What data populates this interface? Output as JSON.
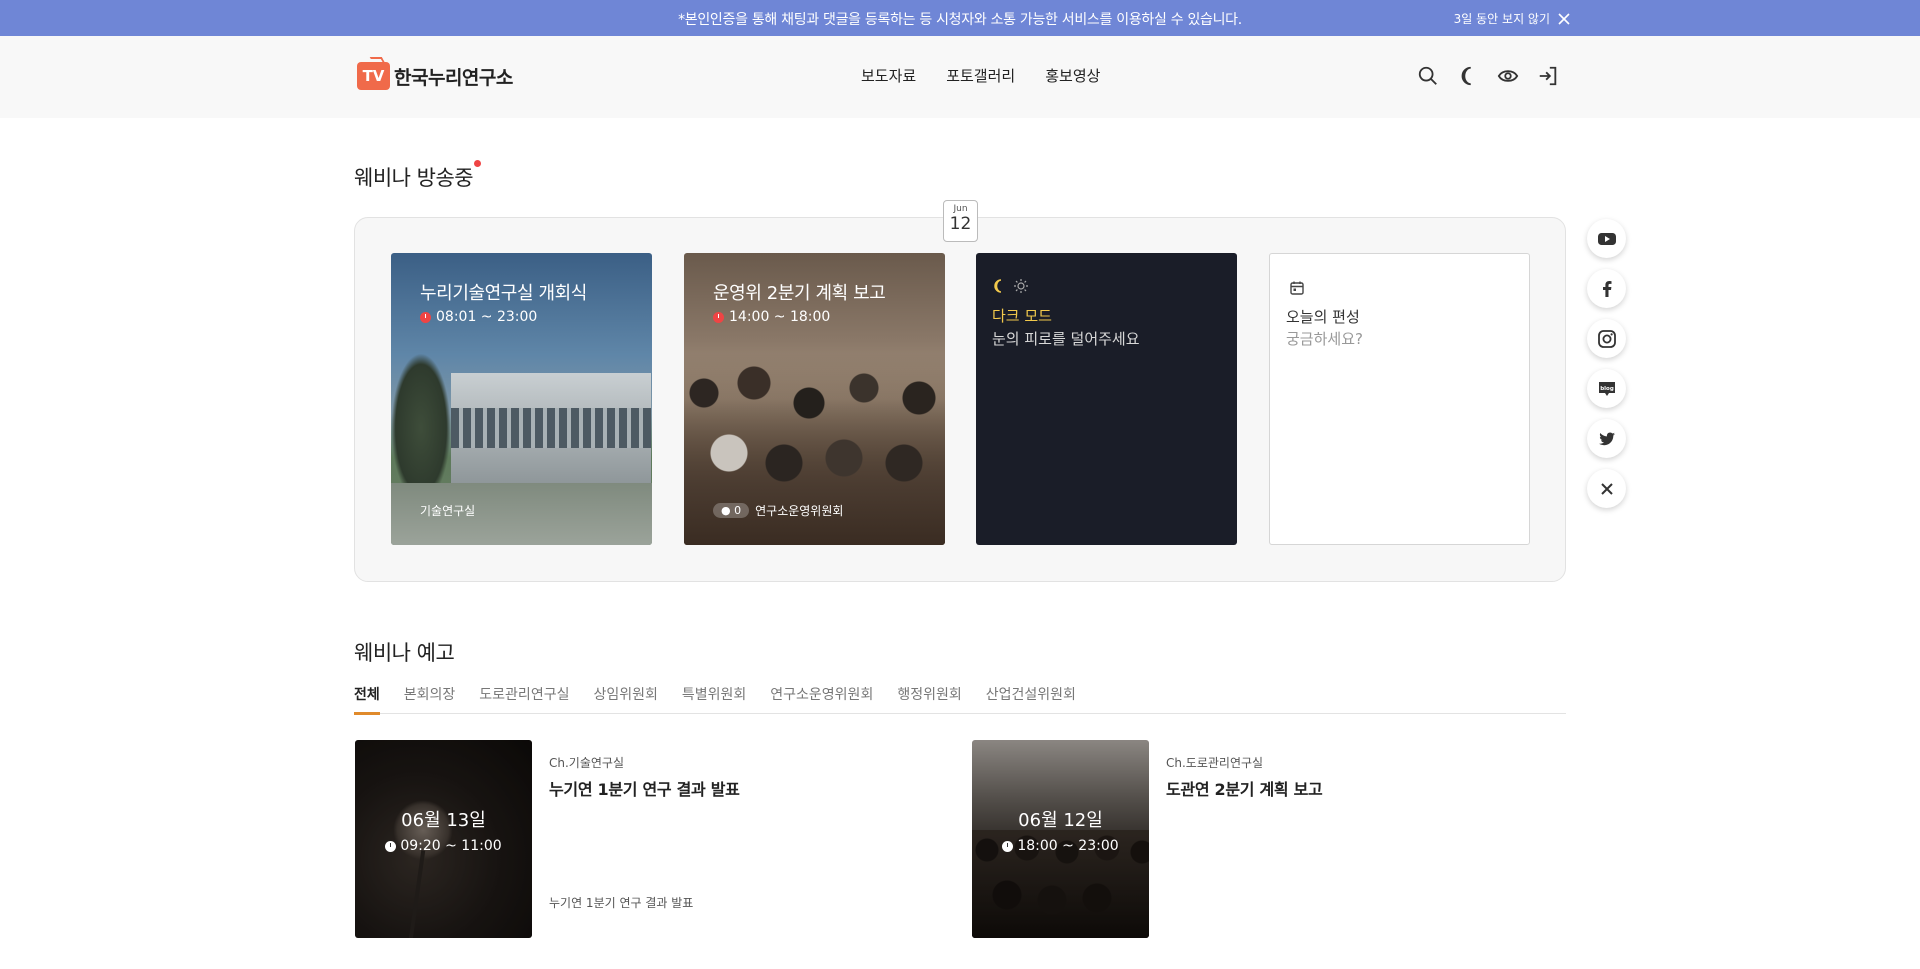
{
  "banner": {
    "text": "*본인인증을 통해 채팅과 댓글을 등록하는 등 시청자와 소통 가능한 서비스를 이용하실 수 있습니다.",
    "dismiss_label": "3일 동안 보지 않기"
  },
  "header": {
    "logo_mark": "TV",
    "logo_text": "한국누리연구소",
    "nav": [
      "보도자료",
      "포토갤러리",
      "홍보영상"
    ],
    "icons": [
      "search-icon",
      "moon-icon",
      "eye-icon",
      "login-icon"
    ]
  },
  "live": {
    "title": "웨비나 방송중",
    "date_month": "Jun",
    "date_day": "12",
    "cards": [
      {
        "title": "누리기술연구실 개회식",
        "time": "08:01 ~ 23:00",
        "channel": "기술연구실"
      },
      {
        "title": "운영위 2분기 계획 보고",
        "time": "14:00 ~ 18:00",
        "viewers": "0",
        "channel": "연구소운영위원회"
      }
    ],
    "dark_mode": {
      "title": "다크 모드",
      "desc": "눈의 피로를 덜어주세요"
    },
    "schedule": {
      "title": "오늘의 편성",
      "desc": "궁금하세요?"
    }
  },
  "social": [
    "youtube-icon",
    "facebook-icon",
    "instagram-icon",
    "blog-icon",
    "twitter-icon",
    "close-icon"
  ],
  "upcoming": {
    "title": "웨비나 예고",
    "tabs": [
      "전체",
      "본회의장",
      "도로관리연구실",
      "상임위원회",
      "특별위원회",
      "연구소운영위원회",
      "행정위원회",
      "산업건설위원회"
    ],
    "items": [
      {
        "date": "06월 13일",
        "time": "09:20 ~ 11:00",
        "channel": "Ch.기술연구실",
        "title": "누기연 1분기 연구 결과 발표",
        "desc": "누기연 1분기 연구 결과 발표"
      },
      {
        "date": "06월 12일",
        "time": "18:00 ~ 23:00",
        "channel": "Ch.도로관리연구실",
        "title": "도관연 2분기 계획 보고"
      }
    ]
  },
  "colors": {
    "banner": "#6f86d6",
    "accent_tab": "#e08a2b",
    "live_dot": "#ef4444",
    "dark_mode_title": "#f2c94c"
  }
}
